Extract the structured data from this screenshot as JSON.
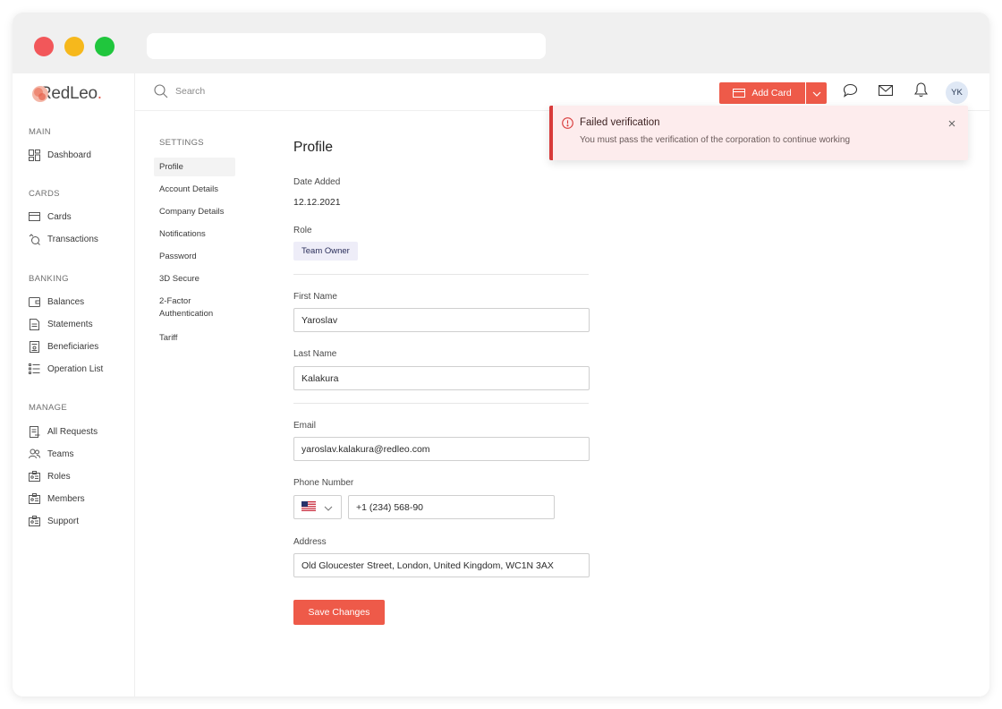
{
  "brand": {
    "name": "RedLeo",
    "accent": "#ee5a49",
    "error": "#d83a3a"
  },
  "topbar": {
    "search_placeholder": "Search",
    "add_card_label": "Add Card",
    "avatar_initials": "YK"
  },
  "sidebar": {
    "sections": [
      {
        "title": "MAIN",
        "items": [
          {
            "label": "Dashboard",
            "icon": "dashboard-icon"
          }
        ]
      },
      {
        "title": "CARDS",
        "items": [
          {
            "label": "Cards",
            "icon": "card-icon"
          },
          {
            "label": "Transactions",
            "icon": "transactions-icon"
          }
        ]
      },
      {
        "title": "BANKING",
        "items": [
          {
            "label": "Balances",
            "icon": "wallet-icon"
          },
          {
            "label": "Statements",
            "icon": "document-icon"
          },
          {
            "label": "Beneficiaries",
            "icon": "beneficiaries-icon"
          },
          {
            "label": "Operation List",
            "icon": "list-icon"
          }
        ]
      },
      {
        "title": "MANAGE",
        "items": [
          {
            "label": "All Requests",
            "icon": "requests-icon"
          },
          {
            "label": "Teams",
            "icon": "teams-icon"
          },
          {
            "label": "Roles",
            "icon": "id-card-icon"
          },
          {
            "label": "Members",
            "icon": "id-card-icon"
          },
          {
            "label": "Support",
            "icon": "id-card-icon"
          }
        ]
      }
    ]
  },
  "settings": {
    "title": "SETTINGS",
    "items": [
      {
        "label": "Profile",
        "active": true
      },
      {
        "label": "Account Details"
      },
      {
        "label": "Company Details"
      },
      {
        "label": "Notifications"
      },
      {
        "label": "Password"
      },
      {
        "label": "3D Secure"
      },
      {
        "label": "2-Factor\nAuthentication"
      },
      {
        "label": "Tariff"
      }
    ]
  },
  "profile": {
    "title": "Profile",
    "date_added_label": "Date Added",
    "date_added_value": "12.12.2021",
    "role_label": "Role",
    "role_value": "Team Owner",
    "first_name_label": "First Name",
    "first_name_value": "Yaroslav",
    "last_name_label": "Last Name",
    "last_name_value": "Kalakura",
    "email_label": "Email",
    "email_value": "yaroslav.kalakura@redleo.com",
    "phone_label": "Phone Number",
    "phone_country": "US",
    "phone_value": "+1 (234) 568-90",
    "address_label": "Address",
    "address_value": "Old Gloucester Street, London, United Kingdom, WC1N 3AX",
    "save_label": "Save Changes"
  },
  "toast": {
    "title": "Failed verification",
    "message": "You must pass the verification of the corporation to continue working"
  }
}
